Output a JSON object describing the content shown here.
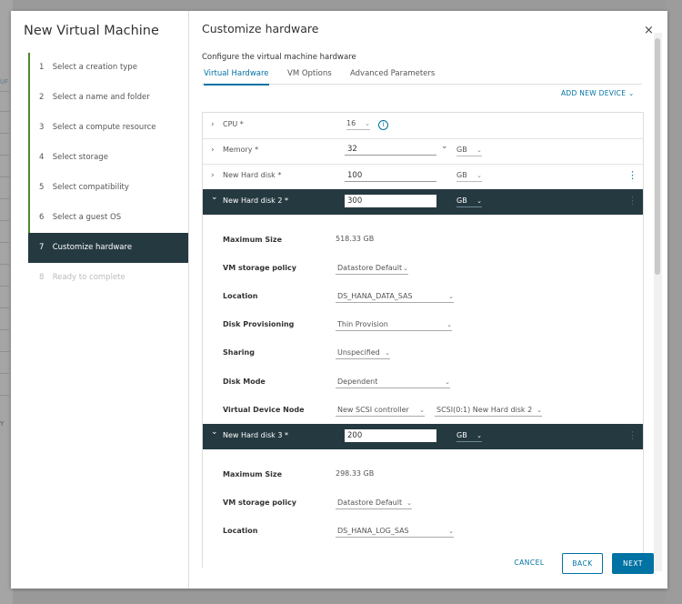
{
  "background": {
    "left_label": "UF",
    "left_label2": "Y"
  },
  "wizard": {
    "title": "New Virtual Machine",
    "steps": [
      {
        "num": "1",
        "label": "Select a creation type",
        "state": "done"
      },
      {
        "num": "2",
        "label": "Select a name and folder",
        "state": "done"
      },
      {
        "num": "3",
        "label": "Select a compute resource",
        "state": "done"
      },
      {
        "num": "4",
        "label": "Select storage",
        "state": "done"
      },
      {
        "num": "5",
        "label": "Select compatibility",
        "state": "done"
      },
      {
        "num": "6",
        "label": "Select a guest OS",
        "state": "done"
      },
      {
        "num": "7",
        "label": "Customize hardware",
        "state": "active"
      },
      {
        "num": "8",
        "label": "Ready to complete",
        "state": "future"
      }
    ]
  },
  "page": {
    "title": "Customize hardware",
    "close_icon": "×",
    "subtitle": "Configure the virtual machine hardware",
    "tabs": [
      "Virtual Hardware",
      "VM Options",
      "Advanced Parameters"
    ],
    "add_device": "ADD NEW DEVICE",
    "add_device_caret": "⌄"
  },
  "hardware": {
    "cpu": {
      "label": "CPU *",
      "value": "16",
      "info": "i"
    },
    "memory": {
      "label": "Memory *",
      "value": "32",
      "unit": "GB"
    },
    "disk1": {
      "label": "New Hard disk *",
      "value": "100",
      "unit": "GB"
    },
    "disk2": {
      "label": "New Hard disk 2 *",
      "value": "300",
      "unit": "GB",
      "fields": {
        "max_size_label": "Maximum Size",
        "max_size": "518.33 GB",
        "policy_label": "VM storage policy",
        "policy": "Datastore Default",
        "location_label": "Location",
        "location": "DS_HANA_DATA_SAS",
        "provisioning_label": "Disk Provisioning",
        "provisioning": "Thin Provision",
        "sharing_label": "Sharing",
        "sharing": "Unspecified",
        "mode_label": "Disk Mode",
        "mode": "Dependent",
        "node_label": "Virtual Device Node",
        "node_controller": "New SCSI controller",
        "node_slot": "SCSI(0:1) New Hard disk 2"
      }
    },
    "disk3": {
      "label": "New Hard disk 3 *",
      "value": "200",
      "unit": "GB",
      "fields": {
        "max_size_label": "Maximum Size",
        "max_size": "298.33 GB",
        "policy_label": "VM storage policy",
        "policy": "Datastore Default",
        "location_label": "Location",
        "location": "DS_HANA_LOG_SAS"
      }
    }
  },
  "icons": {
    "chevron_right": "›",
    "chevron_down": "⌄",
    "kebab": "⋮",
    "caret": "⌄"
  },
  "footer": {
    "cancel": "CANCEL",
    "back": "BACK",
    "next": "NEXT"
  },
  "colors": {
    "accent": "#0072a3",
    "dark": "#253940",
    "step_done": "#4b8a2c"
  }
}
